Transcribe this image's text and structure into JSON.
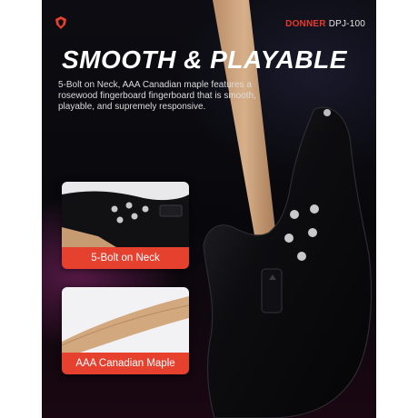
{
  "brand": {
    "name": "DONNER",
    "model": "DPJ-100",
    "logo_icon": "donner-flame-icon",
    "accent_color": "#e6402f"
  },
  "headline": "SMOOTH & PLAYABLE",
  "body": "5-Bolt on Neck, AAA Canadian maple features a rosewood fingerboard fingerboard that is smooth, playable, and supremely responsive.",
  "features": [
    {
      "label": "5-Bolt on Neck",
      "icon": "neck-bolt-photo"
    },
    {
      "label": "AAA Canadian Maple",
      "icon": "maple-neck-photo"
    }
  ]
}
